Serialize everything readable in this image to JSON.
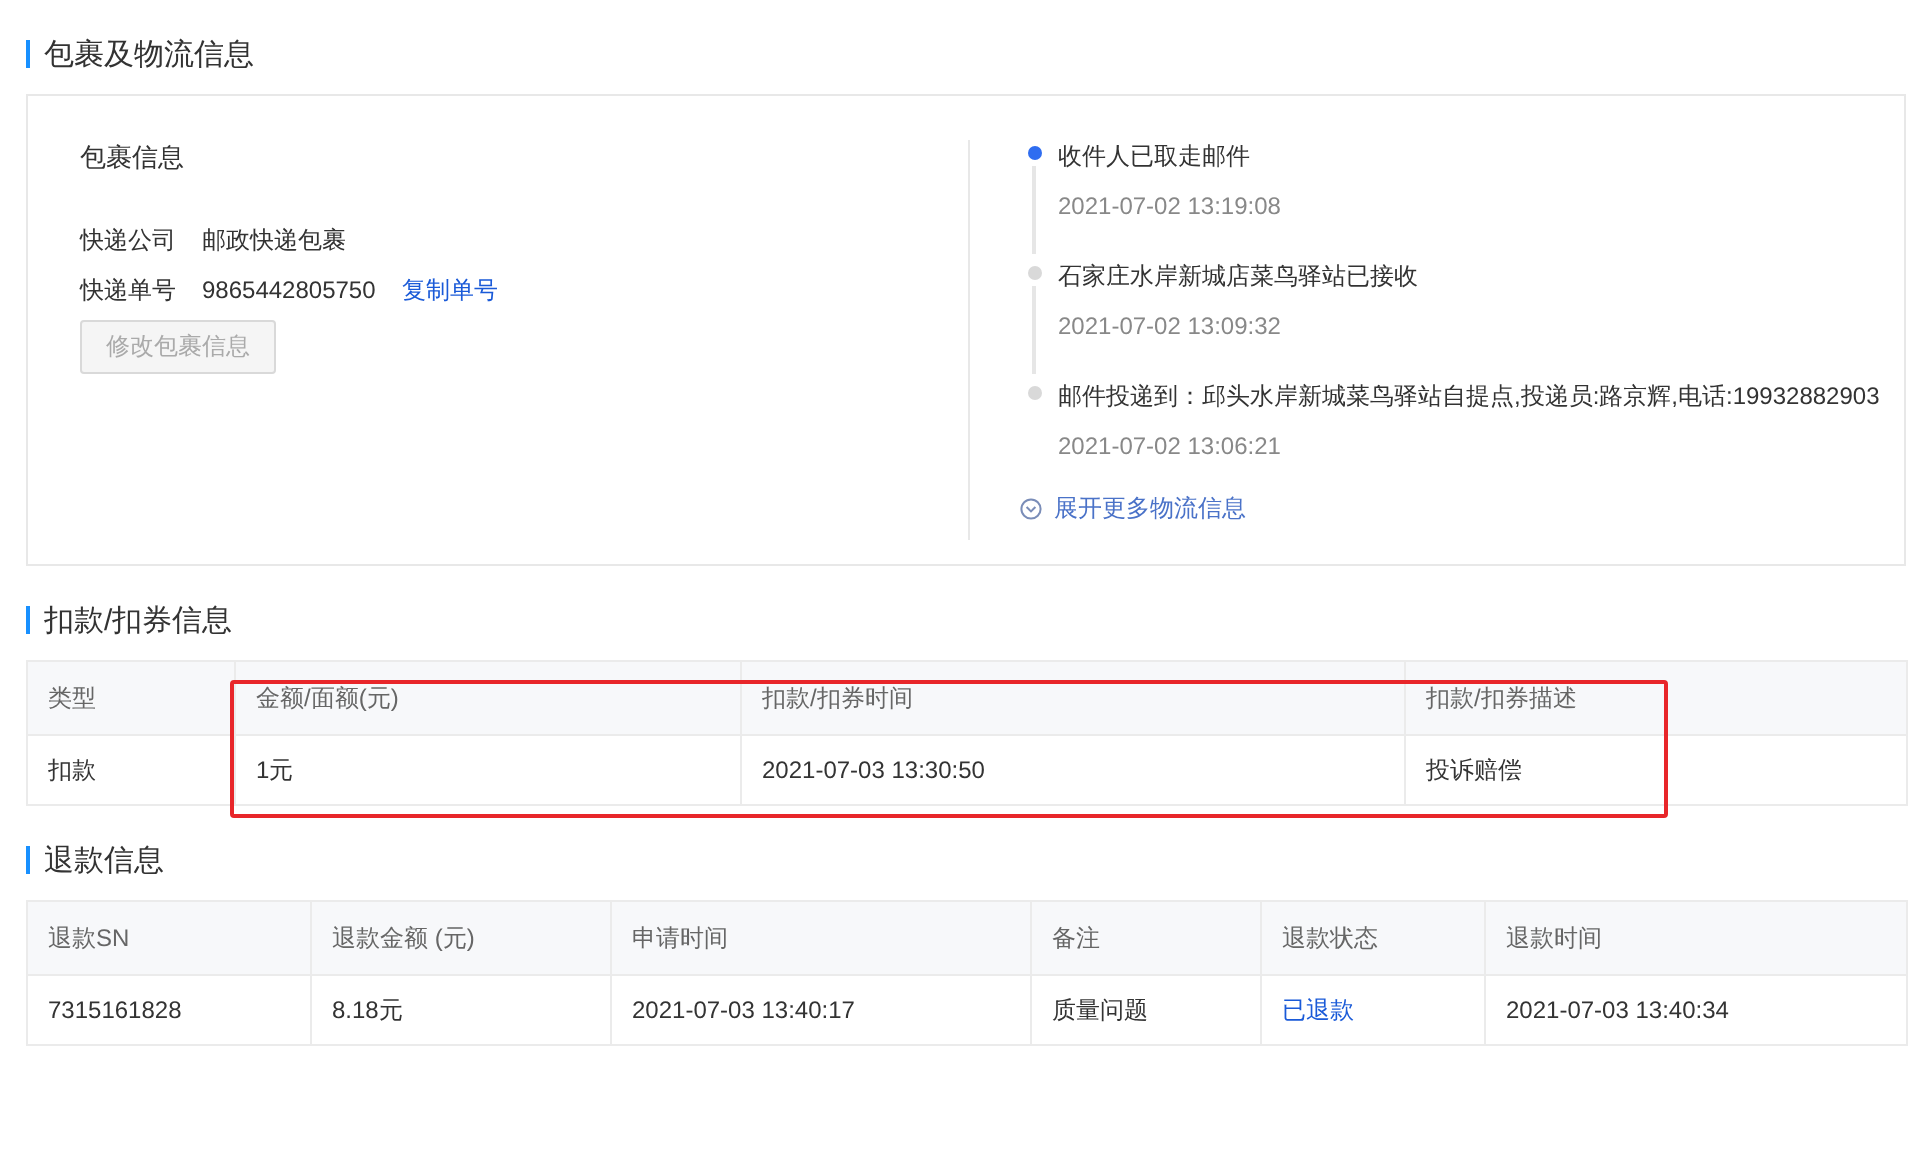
{
  "package_section": {
    "title": "包裹及物流信息",
    "package": {
      "heading": "包裹信息",
      "fields": [
        {
          "label": "快递公司",
          "value": "邮政快递包裹"
        },
        {
          "label": "快递单号",
          "value": "9865442805750",
          "link": "复制单号"
        }
      ],
      "button": {
        "label": "修改包裹信息",
        "disabled": true
      }
    },
    "timeline": [
      {
        "text": "收件人已取走邮件",
        "time": "2021-07-02 13:19:08",
        "current": true
      },
      {
        "text": "石家庄水岸新城店菜鸟驿站已接收",
        "time": "2021-07-02 13:09:32",
        "current": false
      },
      {
        "text": "邮件投递到：邱头水岸新城菜鸟驿站自提点,投递员:路京辉,电话:19932882903",
        "time": "2021-07-02 13:06:21",
        "current": false
      }
    ],
    "expand_link": "展开更多物流信息"
  },
  "deduction_section": {
    "title": "扣款/扣券信息",
    "columns": [
      "类型",
      "金额/面额(元)",
      "扣款/扣券时间",
      "扣款/扣券描述"
    ],
    "rows": [
      [
        {
          "text": "扣款"
        },
        {
          "text": "1元"
        },
        {
          "text": "2021-07-03 13:30:50"
        },
        {
          "text": "投诉赔偿"
        }
      ]
    ]
  },
  "refund_section": {
    "title": "退款信息",
    "columns": [
      "退款SN",
      "退款金额 (元)",
      "申请时间",
      "备注",
      "退款状态",
      "退款时间"
    ],
    "rows": [
      [
        {
          "text": "7315161828"
        },
        {
          "text": "8.18元"
        },
        {
          "text": "2021-07-03 13:40:17"
        },
        {
          "text": "质量问题"
        },
        {
          "text": "已退款",
          "kind": "link"
        },
        {
          "text": "2021-07-03 13:40:34"
        }
      ]
    ]
  }
}
